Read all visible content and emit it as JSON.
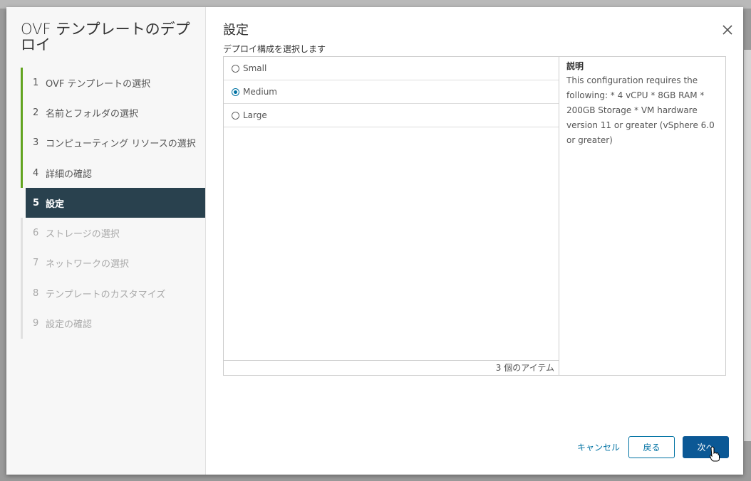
{
  "wizard": {
    "title": "OVF テンプレートのデプロイ",
    "steps": [
      {
        "num": "1",
        "label": "OVF テンプレートの選択",
        "state": "done"
      },
      {
        "num": "2",
        "label": "名前とフォルダの選択",
        "state": "done"
      },
      {
        "num": "3",
        "label": "コンピューティング リソースの選択",
        "state": "done"
      },
      {
        "num": "4",
        "label": "詳細の確認",
        "state": "done"
      },
      {
        "num": "5",
        "label": "設定",
        "state": "active"
      },
      {
        "num": "6",
        "label": "ストレージの選択",
        "state": "pending"
      },
      {
        "num": "7",
        "label": "ネットワークの選択",
        "state": "pending"
      },
      {
        "num": "8",
        "label": "テンプレートのカスタマイズ",
        "state": "pending"
      },
      {
        "num": "9",
        "label": "設定の確認",
        "state": "pending"
      }
    ]
  },
  "main": {
    "title": "設定",
    "subtitle": "デプロイ構成を選択します",
    "options": [
      {
        "label": "Small",
        "selected": false
      },
      {
        "label": "Medium",
        "selected": true
      },
      {
        "label": "Large",
        "selected": false
      }
    ],
    "item_count": "3 個のアイテム",
    "description": {
      "title": "説明",
      "body": "This configuration requires the following: * 4 vCPU * 8GB RAM * 200GB Storage * VM hardware version 11 or greater (vSphere 6.0 or greater)"
    }
  },
  "buttons": {
    "cancel": "キャンセル",
    "back": "戻る",
    "next": "次へ"
  },
  "colors": {
    "active_step_bg": "#29414e",
    "done_bar": "#62a420",
    "primary": "#0b5895",
    "link": "#0072a3"
  }
}
